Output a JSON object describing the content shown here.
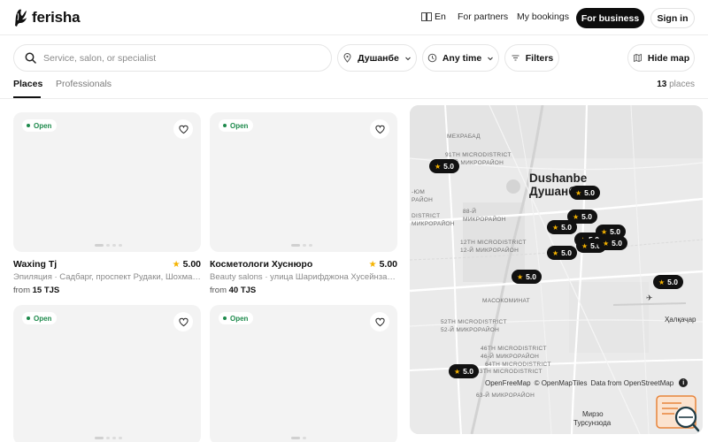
{
  "header": {
    "logo_text": "ferisha",
    "language": "En",
    "for_partners": "For partners",
    "my_bookings": "My bookings",
    "for_business": "For business",
    "sign_in": "Sign in"
  },
  "search": {
    "placeholder": "Service, salon, or specialist",
    "location": "Душанбе",
    "time": "Any time",
    "filters": "Filters",
    "hide_map": "Hide map"
  },
  "tabs": {
    "places": "Places",
    "professionals": "Professionals",
    "count": "13",
    "count_suffix": "places"
  },
  "cards": [
    {
      "status": "Open",
      "title": "Waxing Tj",
      "rating": "5.00",
      "subtitle": "Эпиляция · Садбарг, проспект Рудаки, Шохманс...",
      "price_prefix": "from",
      "price": "15 TJS"
    },
    {
      "status": "Open",
      "title": "Косметологи Хуснюро",
      "rating": "5.00",
      "subtitle": "Beauty salons · улица Шарифджона Хусейнзаде, ...",
      "price_prefix": "from",
      "price": "40 TJS"
    },
    {
      "status": "Open"
    },
    {
      "status": "Open"
    }
  ],
  "map": {
    "city_latin": "Dushanbe",
    "city_cyrillic": "Душанбе",
    "district_labels": {
      "l1": "МЕХРАБАД",
      "l2": "91TH MICRODISTRICT",
      "l3": "91-Й МИКРОРАЙОН",
      "l4": "-ЮМ",
      "l5": "РАЙОН",
      "l6": "88-Й",
      "l7": "МИКРОРАЙОН",
      "l8": "DISTRICT",
      "l9": "МИКРОРАЙОН",
      "l10": "12TH MICRODISTRICT",
      "l11": "12-Й МИКРОРАЙОН",
      "l12": "МАСОКОМИНАТ",
      "l13": "52TH MICRODISTRICT",
      "l14": "52-Й МИКРОРАЙОН",
      "l15": "46TH MICRODISTRICT",
      "l16": "46-Й МИКРОРАЙОН",
      "l17": "64TH MICRODISTRICT",
      "l18": "63TH MICRODISTRICT",
      "l19": "63-Й МИКРОРАЙОН"
    },
    "place_halqajar": "Ҳалқаҷар",
    "place_mirzo_1": "Мирзо",
    "place_mirzo_2": "Турсунзода",
    "attribution_1": "OpenFreeMap",
    "attribution_2": "© OpenMapTiles",
    "attribution_3": "Data from OpenStreetMap",
    "markers": [
      "5.0",
      "5.0",
      "5.0",
      "5.0",
      "5.0",
      "5.0",
      "5.0",
      "5.0",
      "5.0",
      "5.0",
      "5.0",
      "5.0"
    ]
  },
  "colors": {
    "accent_dark": "#0d0d0d",
    "open_green": "#1e8a4c",
    "star_yellow": "#f5b300"
  }
}
